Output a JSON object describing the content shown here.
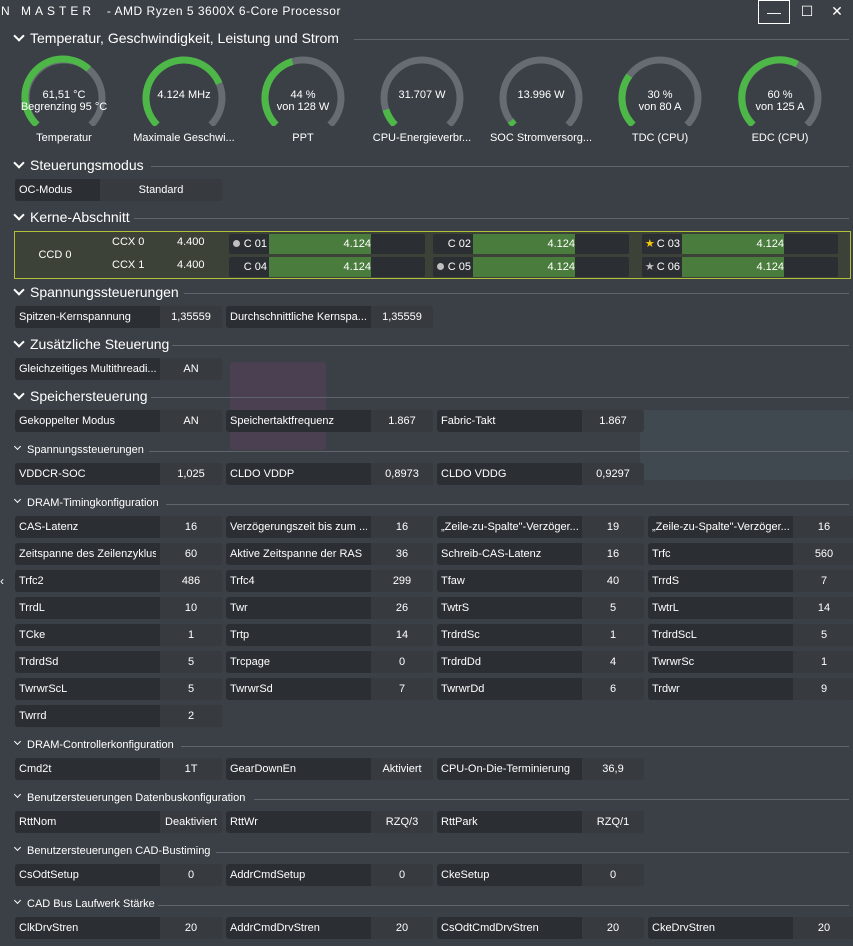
{
  "window": {
    "brand": "N  MASTER",
    "title": "-  AMD Ryzen 5 3600X 6-Core Processor",
    "min": "—",
    "max": "☐",
    "close": "✕"
  },
  "sections": {
    "temp": "Temperatur, Geschwindigkeit, Leistung und Strom",
    "mode": "Steuerungsmodus",
    "cores": "Kerne-Abschnitt",
    "volt": "Spannungssteuerungen",
    "extra": "Zusätzliche Steuerung",
    "mem": "Speichersteuerung",
    "volt2": "Spannungssteuerungen",
    "dram": "DRAM-Timingkonfiguration",
    "ctrl": "DRAM-Controllerkonfiguration",
    "bus": "Benutzersteuerungen Datenbuskonfiguration",
    "cad": "Benutzersteuerungen CAD-Bustiming",
    "drive": "CAD Bus Laufwerk Stärke"
  },
  "gauges": [
    {
      "l1": "61,51 °C",
      "l2": "Begrenzing 95 °C",
      "label": "Temperatur",
      "fill": 0.65,
      "color": "#4db848"
    },
    {
      "l1": "4.124  MHz",
      "l2": "",
      "label": "Maximale Geschwi...",
      "fill": 0.75,
      "color": "#4db848"
    },
    {
      "l1": "44 %",
      "l2": "von 128 W",
      "label": "PPT",
      "fill": 0.44,
      "color": "#4db848"
    },
    {
      "l1": "31.707 W",
      "l2": "",
      "label": "CPU-Energieverbr...",
      "fill": 0.1,
      "color": "#4db848"
    },
    {
      "l1": "13.996 W",
      "l2": "",
      "label": "SOC Stromversorg...",
      "fill": 0.03,
      "color": "#4db848"
    },
    {
      "l1": "30 %",
      "l2": "von 80 A",
      "label": "TDC (CPU)",
      "fill": 0.3,
      "color": "#4db848"
    },
    {
      "l1": "60 %",
      "l2": "von 125 A",
      "label": "EDC (CPU)",
      "fill": 0.6,
      "color": "#4db848"
    }
  ],
  "mode": {
    "key": "OC-Modus",
    "value": "Standard"
  },
  "ccd": "CCD 0",
  "ccx": [
    {
      "name": "CCX 0",
      "freq": "4.400"
    },
    {
      "name": "CCX 1",
      "freq": "4.400"
    }
  ],
  "cores": [
    {
      "name": "C 01",
      "freq": "4.124",
      "marker": "dot"
    },
    {
      "name": "C 02",
      "freq": "4.124",
      "marker": ""
    },
    {
      "name": "C 03",
      "freq": "4.124",
      "marker": "star"
    },
    {
      "name": "C 04",
      "freq": "4.124",
      "marker": ""
    },
    {
      "name": "C 05",
      "freq": "4.124",
      "marker": "dot"
    },
    {
      "name": "C 06",
      "freq": "4.124",
      "marker": "star-grey"
    }
  ],
  "voltage": [
    {
      "key": "Spitzen-Kernspannung",
      "value": "1,35559"
    },
    {
      "key": "Durchschnittliche Kernspa...",
      "value": "1,35559"
    }
  ],
  "extra": [
    {
      "key": "Gleichzeitiges Multithreadi...",
      "value": "AN"
    }
  ],
  "memory": [
    {
      "key": "Gekoppelter Modus",
      "value": "AN"
    },
    {
      "key": "Speichertaktfrequenz",
      "value": "1.867"
    },
    {
      "key": "Fabric-Takt",
      "value": "1.867"
    }
  ],
  "voltage2": [
    {
      "key": "VDDCR-SOC",
      "value": "1,025"
    },
    {
      "key": "CLDO VDDP",
      "value": "0,8973"
    },
    {
      "key": "CLDO VDDG",
      "value": "0,9297"
    }
  ],
  "dram": [
    {
      "key": "CAS-Latenz",
      "value": "16"
    },
    {
      "key": "Verzögerungszeit bis zum ...",
      "value": "16"
    },
    {
      "key": "„Zeile-zu-Spalte\"-Verzöger...",
      "value": "19"
    },
    {
      "key": "„Zeile-zu-Spalte\"-Verzöger...",
      "value": "16"
    },
    {
      "key": "Zeitspanne des Zeilenzyklus",
      "value": "60"
    },
    {
      "key": "Aktive Zeitspanne der RAS",
      "value": "36"
    },
    {
      "key": "Schreib-CAS-Latenz",
      "value": "16"
    },
    {
      "key": "Trfc",
      "value": "560"
    },
    {
      "key": "Trfc2",
      "value": "486"
    },
    {
      "key": "Trfc4",
      "value": "299"
    },
    {
      "key": "Tfaw",
      "value": "40"
    },
    {
      "key": "TrrdS",
      "value": "7"
    },
    {
      "key": "TrrdL",
      "value": "10"
    },
    {
      "key": "Twr",
      "value": "26"
    },
    {
      "key": "TwtrS",
      "value": "5"
    },
    {
      "key": "TwtrL",
      "value": "14"
    },
    {
      "key": "TCke",
      "value": "1"
    },
    {
      "key": "Trtp",
      "value": "14"
    },
    {
      "key": "TrdrdSc",
      "value": "1"
    },
    {
      "key": "TrdrdScL",
      "value": "5"
    },
    {
      "key": "TrdrdSd",
      "value": "5"
    },
    {
      "key": "Trcpage",
      "value": "0"
    },
    {
      "key": "TrdrdDd",
      "value": "4"
    },
    {
      "key": "TwrwrSc",
      "value": "1"
    },
    {
      "key": "TwrwrScL",
      "value": "5"
    },
    {
      "key": "TwrwrSd",
      "value": "7"
    },
    {
      "key": "TwrwrDd",
      "value": "6"
    },
    {
      "key": "Trdwr",
      "value": "9"
    },
    {
      "key": "Twrrd",
      "value": "2"
    }
  ],
  "controller": [
    {
      "key": "Cmd2t",
      "value": "1T"
    },
    {
      "key": "GearDownEn",
      "value": "Aktiviert"
    },
    {
      "key": "CPU-On-Die-Terminierung",
      "value": "36,9"
    }
  ],
  "bus": [
    {
      "key": "RttNom",
      "value": "Deaktiviert"
    },
    {
      "key": "RttWr",
      "value": "RZQ/3"
    },
    {
      "key": "RttPark",
      "value": "RZQ/1"
    }
  ],
  "cad": [
    {
      "key": "CsOdtSetup",
      "value": "0"
    },
    {
      "key": "AddrCmdSetup",
      "value": "0"
    },
    {
      "key": "CkeSetup",
      "value": "0"
    }
  ],
  "drive": [
    {
      "key": "ClkDrvStren",
      "value": "20"
    },
    {
      "key": "AddrCmdDrvStren",
      "value": "20"
    },
    {
      "key": "CsOdtCmdDrvStren",
      "value": "20"
    },
    {
      "key": "CkeDrvStren",
      "value": "20"
    }
  ],
  "back_icon": "‹"
}
